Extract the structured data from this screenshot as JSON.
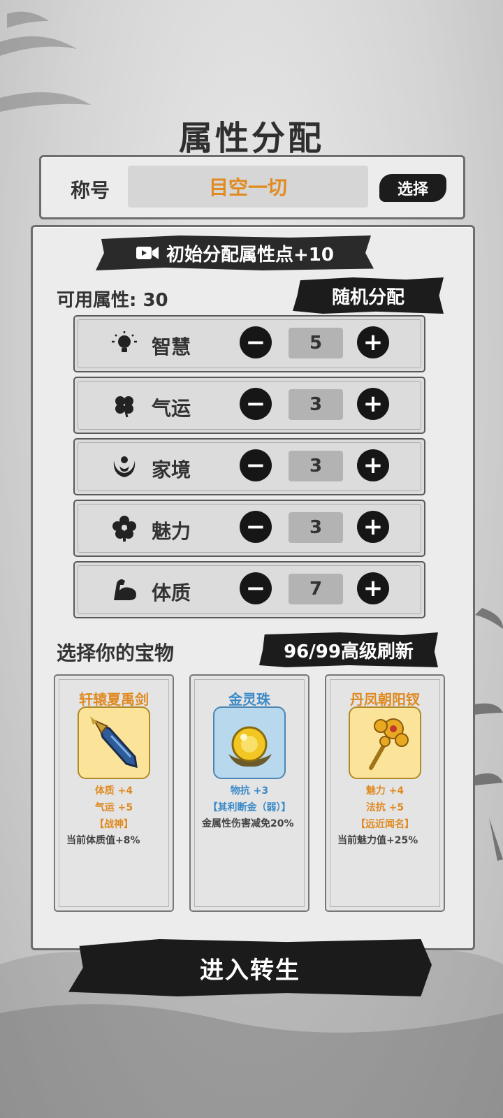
{
  "page": {
    "title": "属性分配"
  },
  "title_section": {
    "label": "称号",
    "value": "目空一切",
    "select_label": "选择"
  },
  "initial_bonus": {
    "label": "初始分配属性点+10",
    "icon": "video-camera-icon"
  },
  "available": {
    "label": "可用属性: 30"
  },
  "random_button": {
    "label": "随机分配"
  },
  "attributes": [
    {
      "name": "智慧",
      "icon": "lightbulb-icon",
      "value": "5"
    },
    {
      "name": "气运",
      "icon": "clover-icon",
      "value": "3"
    },
    {
      "name": "家境",
      "icon": "family-icon",
      "value": "3"
    },
    {
      "name": "魅力",
      "icon": "flower-icon",
      "value": "3"
    },
    {
      "name": "体质",
      "icon": "muscle-arm-icon",
      "value": "7"
    }
  ],
  "controls": {
    "minus": "−",
    "plus": "+"
  },
  "treasure": {
    "heading": "选择你的宝物",
    "refresh_label": "96/99高级刷新",
    "cards": [
      {
        "name": "轩辕夏禹剑",
        "icon": "sword-icon",
        "name_color": "#e08a20",
        "bg": "#fbe49a",
        "stats": [
          "体质 +4",
          "气运 +5"
        ],
        "tag": "【战神】",
        "desc": "当前体质值+8%",
        "stat_color": "#e08a20"
      },
      {
        "name": "金灵珠",
        "icon": "golden-pearl-icon",
        "name_color": "#3a8ac8",
        "bg": "#b8d8ee",
        "stats": [
          "物抗 +3"
        ],
        "tag": "【其利断金（弱）】",
        "desc": "金属性伤害减免20%",
        "stat_color": "#3a8ac8"
      },
      {
        "name": "丹凤朝阳钗",
        "icon": "phoenix-hairpin-icon",
        "name_color": "#e08a20",
        "bg": "#fbe49a",
        "stats": [
          "魅力 +4",
          "法抗 +5"
        ],
        "tag": "【远近闻名】",
        "desc": "当前魅力值+25%",
        "stat_color": "#e08a20"
      }
    ]
  },
  "enter_button": {
    "label": "进入转生"
  }
}
